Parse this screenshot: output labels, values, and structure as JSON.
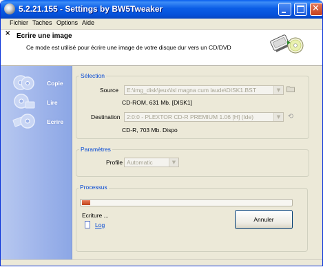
{
  "window": {
    "title": "5.2.21.155 - Settings by BW5Tweaker"
  },
  "menu": [
    "Fichier",
    "Taches",
    "Options",
    "Aide"
  ],
  "header": {
    "close_glyph": "×",
    "title": "Ecrire une image",
    "description": "Ce mode est utilisé pour écrire une image de votre disque dur vers un CD/DVD"
  },
  "sidebar": [
    {
      "label": "Copie",
      "icon": "cd-copy-icon"
    },
    {
      "label": "Lire",
      "icon": "cd-read-icon"
    },
    {
      "label": "Ecrire",
      "icon": "cd-write-icon"
    }
  ],
  "selection": {
    "group_label": "Sélection",
    "source_label": "Source",
    "source_value": "E:\\img_disk\\jeux\\lsl magna cum laude\\DISK1.BST",
    "source_info": "CD-ROM, 631 Mb. [DISK1]",
    "destination_label": "Destination",
    "destination_value": "2:0:0 - PLEXTOR CD-R   PREMIUM 1.06 [H] (Ide)",
    "destination_info": "CD-R, 703 Mb. Dispo"
  },
  "parametres": {
    "group_label": "Paramètres",
    "profile_label": "Profile",
    "profile_value": "Automatic"
  },
  "processus": {
    "group_label": "Processus",
    "progress_fraction": 0.04,
    "status": "Ecriture ...",
    "log_label": "Log",
    "cancel_label": "Annuler"
  },
  "colors": {
    "title_bar": "#0A5FEF",
    "group_label": "#0046D5",
    "progress_fill": "#D55A33",
    "sidebar": "#9DB3EA"
  }
}
